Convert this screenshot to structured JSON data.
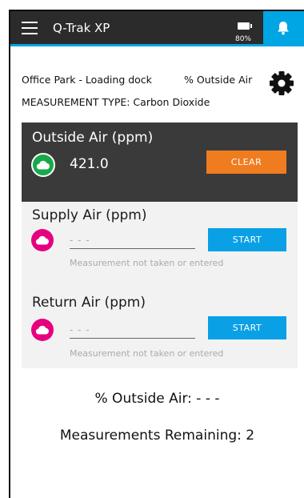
{
  "app": {
    "title": "Q-Trak XP",
    "battery_text": "80%"
  },
  "info": {
    "location": "Office Park - Loading dock",
    "mode": "% Outside Air",
    "measurement_type": "MEASUREMENT TYPE: Carbon Dioxide"
  },
  "outside_air": {
    "label": "Outside Air (ppm)",
    "value": "421.0",
    "button": "CLEAR"
  },
  "supply_air": {
    "label": "Supply Air (ppm)",
    "placeholder": "- - -",
    "button": "START",
    "hint": "Measurement not taken or entered"
  },
  "return_air": {
    "label": "Return Air (ppm)",
    "placeholder": "- - -",
    "button": "START",
    "hint": "Measurement not taken or entered"
  },
  "summary": {
    "percent_outside_air": "% Outside Air: - - -",
    "remaining": "Measurements Remaining: 2"
  },
  "colors": {
    "appbar": "#2b2b2b",
    "accent": "#00a5e3",
    "outside_card": "#3a3a3a",
    "clear_button": "#f07c20",
    "start_button": "#0aa0e6",
    "green_badge": "#1aa84a",
    "pink_badge": "#e6007e"
  },
  "icons": {
    "menu": "hamburger-icon",
    "battery": "battery-icon",
    "notifications": "bell-icon",
    "settings": "gear-icon",
    "air_reading": "cloud-icon"
  }
}
